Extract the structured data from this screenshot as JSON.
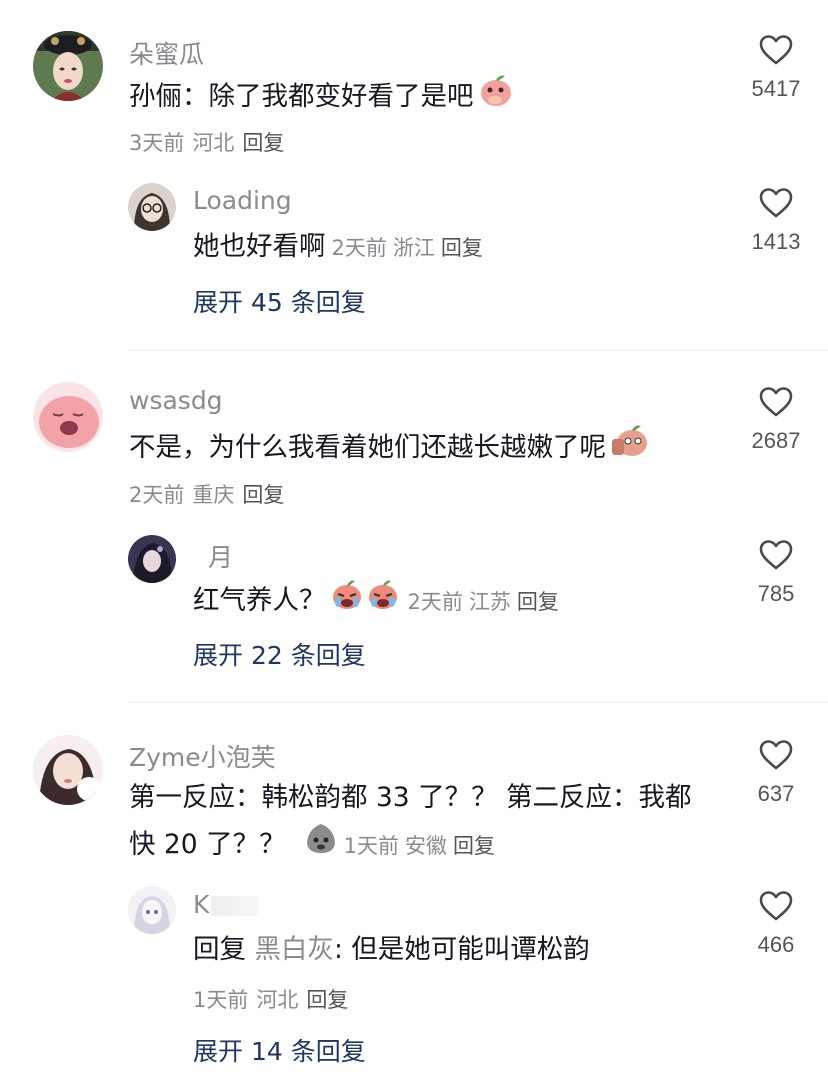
{
  "threads": [
    {
      "comment": {
        "username": "朵蜜瓜",
        "text": "孙俪：除了我都变好看了是吧",
        "emoji": "face-with-hand-over-mouth-peach-emoji",
        "time": "3天前",
        "location": "河北",
        "reply_label": "回复",
        "likes": "5417"
      },
      "reply": {
        "username": "Loading",
        "text": "她也好看啊",
        "time": "2天前",
        "location": "浙江",
        "reply_label": "回复",
        "likes": "1413"
      },
      "expand_label": "展开 45 条回复"
    },
    {
      "comment": {
        "username": "wsasdg",
        "text": "不是，为什么我看着她们还越长越嫩了呢",
        "emoji": "thinking-peach-emoji",
        "time": "2天前",
        "location": "重庆",
        "reply_label": "回复",
        "likes": "2687"
      },
      "reply": {
        "username": "月",
        "text": "红气养人？",
        "emoji": "crying-peach-emoji",
        "time": "2天前",
        "location": "江苏",
        "reply_label": "回复",
        "likes": "785"
      },
      "expand_label": "展开 22 条回复"
    },
    {
      "comment": {
        "username": "Zyme小泡芙",
        "text_line1": "第一反应：韩松韵都 33 了？？ 第二反应：我都",
        "text_line2": "快 20 了？？",
        "emoji": "gray-blob-emoji",
        "time": "1天前",
        "location": "安徽",
        "reply_label": "回复",
        "likes": "637"
      },
      "reply": {
        "username": "K",
        "reply_prefix": "回复",
        "reply_to": "黑白灰",
        "text": ": 但是她可能叫谭松韵",
        "time": "1天前",
        "location": "河北",
        "reply_label": "回复",
        "likes": "466"
      },
      "expand_label": "展开 14 条回复"
    }
  ],
  "icons": {
    "like": "heart-outline-icon"
  },
  "colors": {
    "text": "#161823",
    "meta": "#8a8b91",
    "expand": "#1f3761",
    "divider": "#ececec"
  }
}
